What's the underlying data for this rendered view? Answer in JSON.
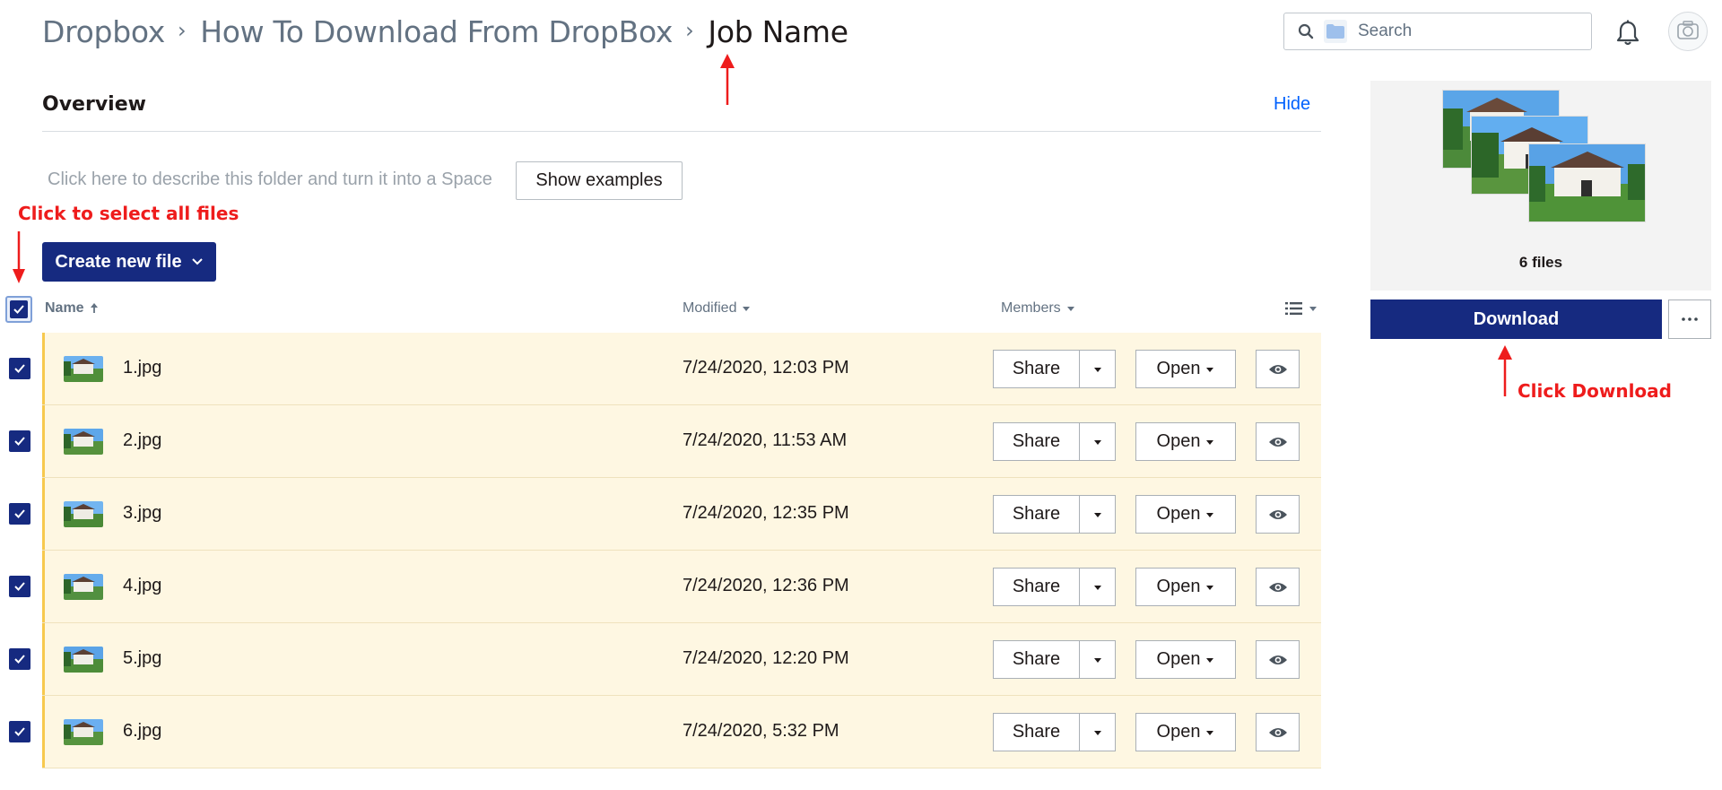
{
  "breadcrumb": {
    "root": "Dropbox",
    "parent": "How To Download From DropBox",
    "current": "Job Name"
  },
  "search": {
    "placeholder": "Search"
  },
  "overview": {
    "title": "Overview",
    "hide_label": "Hide",
    "description_prompt": "Click here to describe this folder and turn it into a Space",
    "show_examples_label": "Show examples"
  },
  "toolbar": {
    "create_label": "Create new file"
  },
  "table": {
    "headers": {
      "name": "Name",
      "modified": "Modified",
      "members": "Members"
    },
    "all_selected": true,
    "rows": [
      {
        "name": "1.jpg",
        "modified": "7/24/2020, 12:03 PM",
        "selected": true
      },
      {
        "name": "2.jpg",
        "modified": "7/24/2020, 11:53 AM",
        "selected": true
      },
      {
        "name": "3.jpg",
        "modified": "7/24/2020, 12:35 PM",
        "selected": true
      },
      {
        "name": "4.jpg",
        "modified": "7/24/2020, 12:36 PM",
        "selected": true
      },
      {
        "name": "5.jpg",
        "modified": "7/24/2020, 12:20 PM",
        "selected": true
      },
      {
        "name": "6.jpg",
        "modified": "7/24/2020, 5:32 PM",
        "selected": true
      }
    ],
    "actions": {
      "share": "Share",
      "open": "Open"
    }
  },
  "preview": {
    "files_count": "6 files",
    "download_label": "Download"
  },
  "annotations": {
    "select_all": "Click to select all files",
    "download": "Click Download"
  },
  "colors": {
    "primary": "#162a80",
    "selected_row": "#fef7e2",
    "row_accent": "#f7c94e",
    "annotation": "#ee1c1c",
    "link": "#0061fe"
  },
  "icons": {
    "search": "search-icon",
    "folder": "folder-icon",
    "bell": "bell-icon",
    "avatar": "avatar",
    "eye": "eye-icon",
    "more": "more-icon",
    "list_view": "list-view-icon"
  }
}
